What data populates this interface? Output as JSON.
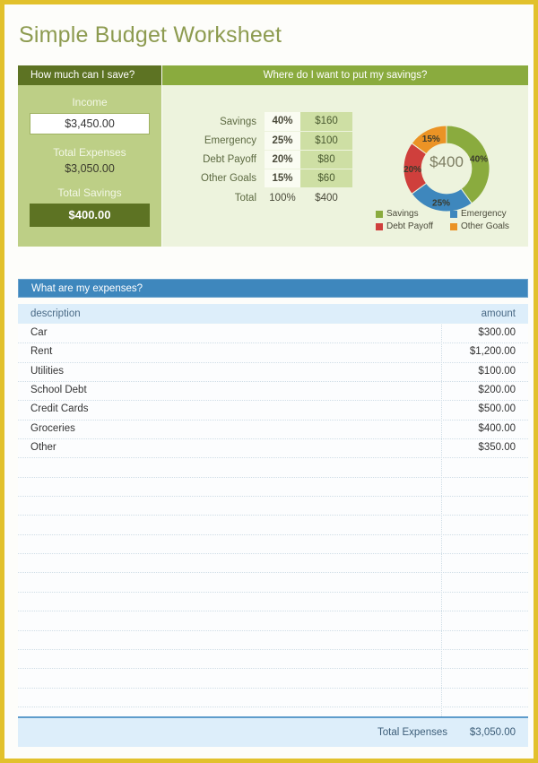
{
  "page": {
    "title": "Simple Budget Worksheet",
    "border_color": "#e2c12c",
    "title_color": "#8d9b50"
  },
  "save_panel": {
    "header": "How much can I save?",
    "income_label": "Income",
    "income_value": "$3,450.00",
    "total_expenses_label": "Total Expenses",
    "total_expenses_value": "$3,050.00",
    "total_savings_label": "Total Savings",
    "total_savings_value": "$400.00",
    "header_color": "#5d7323",
    "body_color": "#bdcf86"
  },
  "savings_panel": {
    "header": "Where do I want to put my savings?",
    "header_color": "#8aab3e",
    "body_color": "#edf3dd",
    "rows": [
      {
        "label": "Savings",
        "percent": "40%",
        "amount": "$160"
      },
      {
        "label": "Emergency",
        "percent": "25%",
        "amount": "$100"
      },
      {
        "label": "Debt Payoff",
        "percent": "20%",
        "amount": "$80"
      },
      {
        "label": "Other Goals",
        "percent": "15%",
        "amount": "$60"
      }
    ],
    "total": {
      "label": "Total",
      "percent": "100%",
      "amount": "$400"
    }
  },
  "chart_data": {
    "type": "pie",
    "title": "",
    "center_label": "$400",
    "categories": [
      "Savings",
      "Emergency",
      "Debt Payoff",
      "Other Goals"
    ],
    "values": [
      40,
      25,
      20,
      15
    ],
    "amounts": [
      160,
      100,
      80,
      60
    ],
    "data_labels": [
      "40%",
      "25%",
      "20%",
      "15%"
    ],
    "colors": [
      "#8aab3e",
      "#3e87bd",
      "#cf3f3c",
      "#eb9325"
    ],
    "legend_position": "bottom",
    "grid": false,
    "donut_hole_ratio": 0.58,
    "start_angle_deg": 0
  },
  "expenses": {
    "header": "What are my expenses?",
    "header_color": "#3e87bd",
    "columns": {
      "description": "description",
      "amount": "amount"
    },
    "rows": [
      {
        "description": "Car",
        "amount": "$300.00"
      },
      {
        "description": "Rent",
        "amount": "$1,200.00"
      },
      {
        "description": "Utilities",
        "amount": "$100.00"
      },
      {
        "description": "School Debt",
        "amount": "$200.00"
      },
      {
        "description": "Credit Cards",
        "amount": "$500.00"
      },
      {
        "description": "Groceries",
        "amount": "$400.00"
      },
      {
        "description": "Other",
        "amount": "$350.00"
      }
    ],
    "empty_row_count": 14,
    "footer": {
      "label": "Total Expenses",
      "value": "$3,050.00"
    }
  }
}
